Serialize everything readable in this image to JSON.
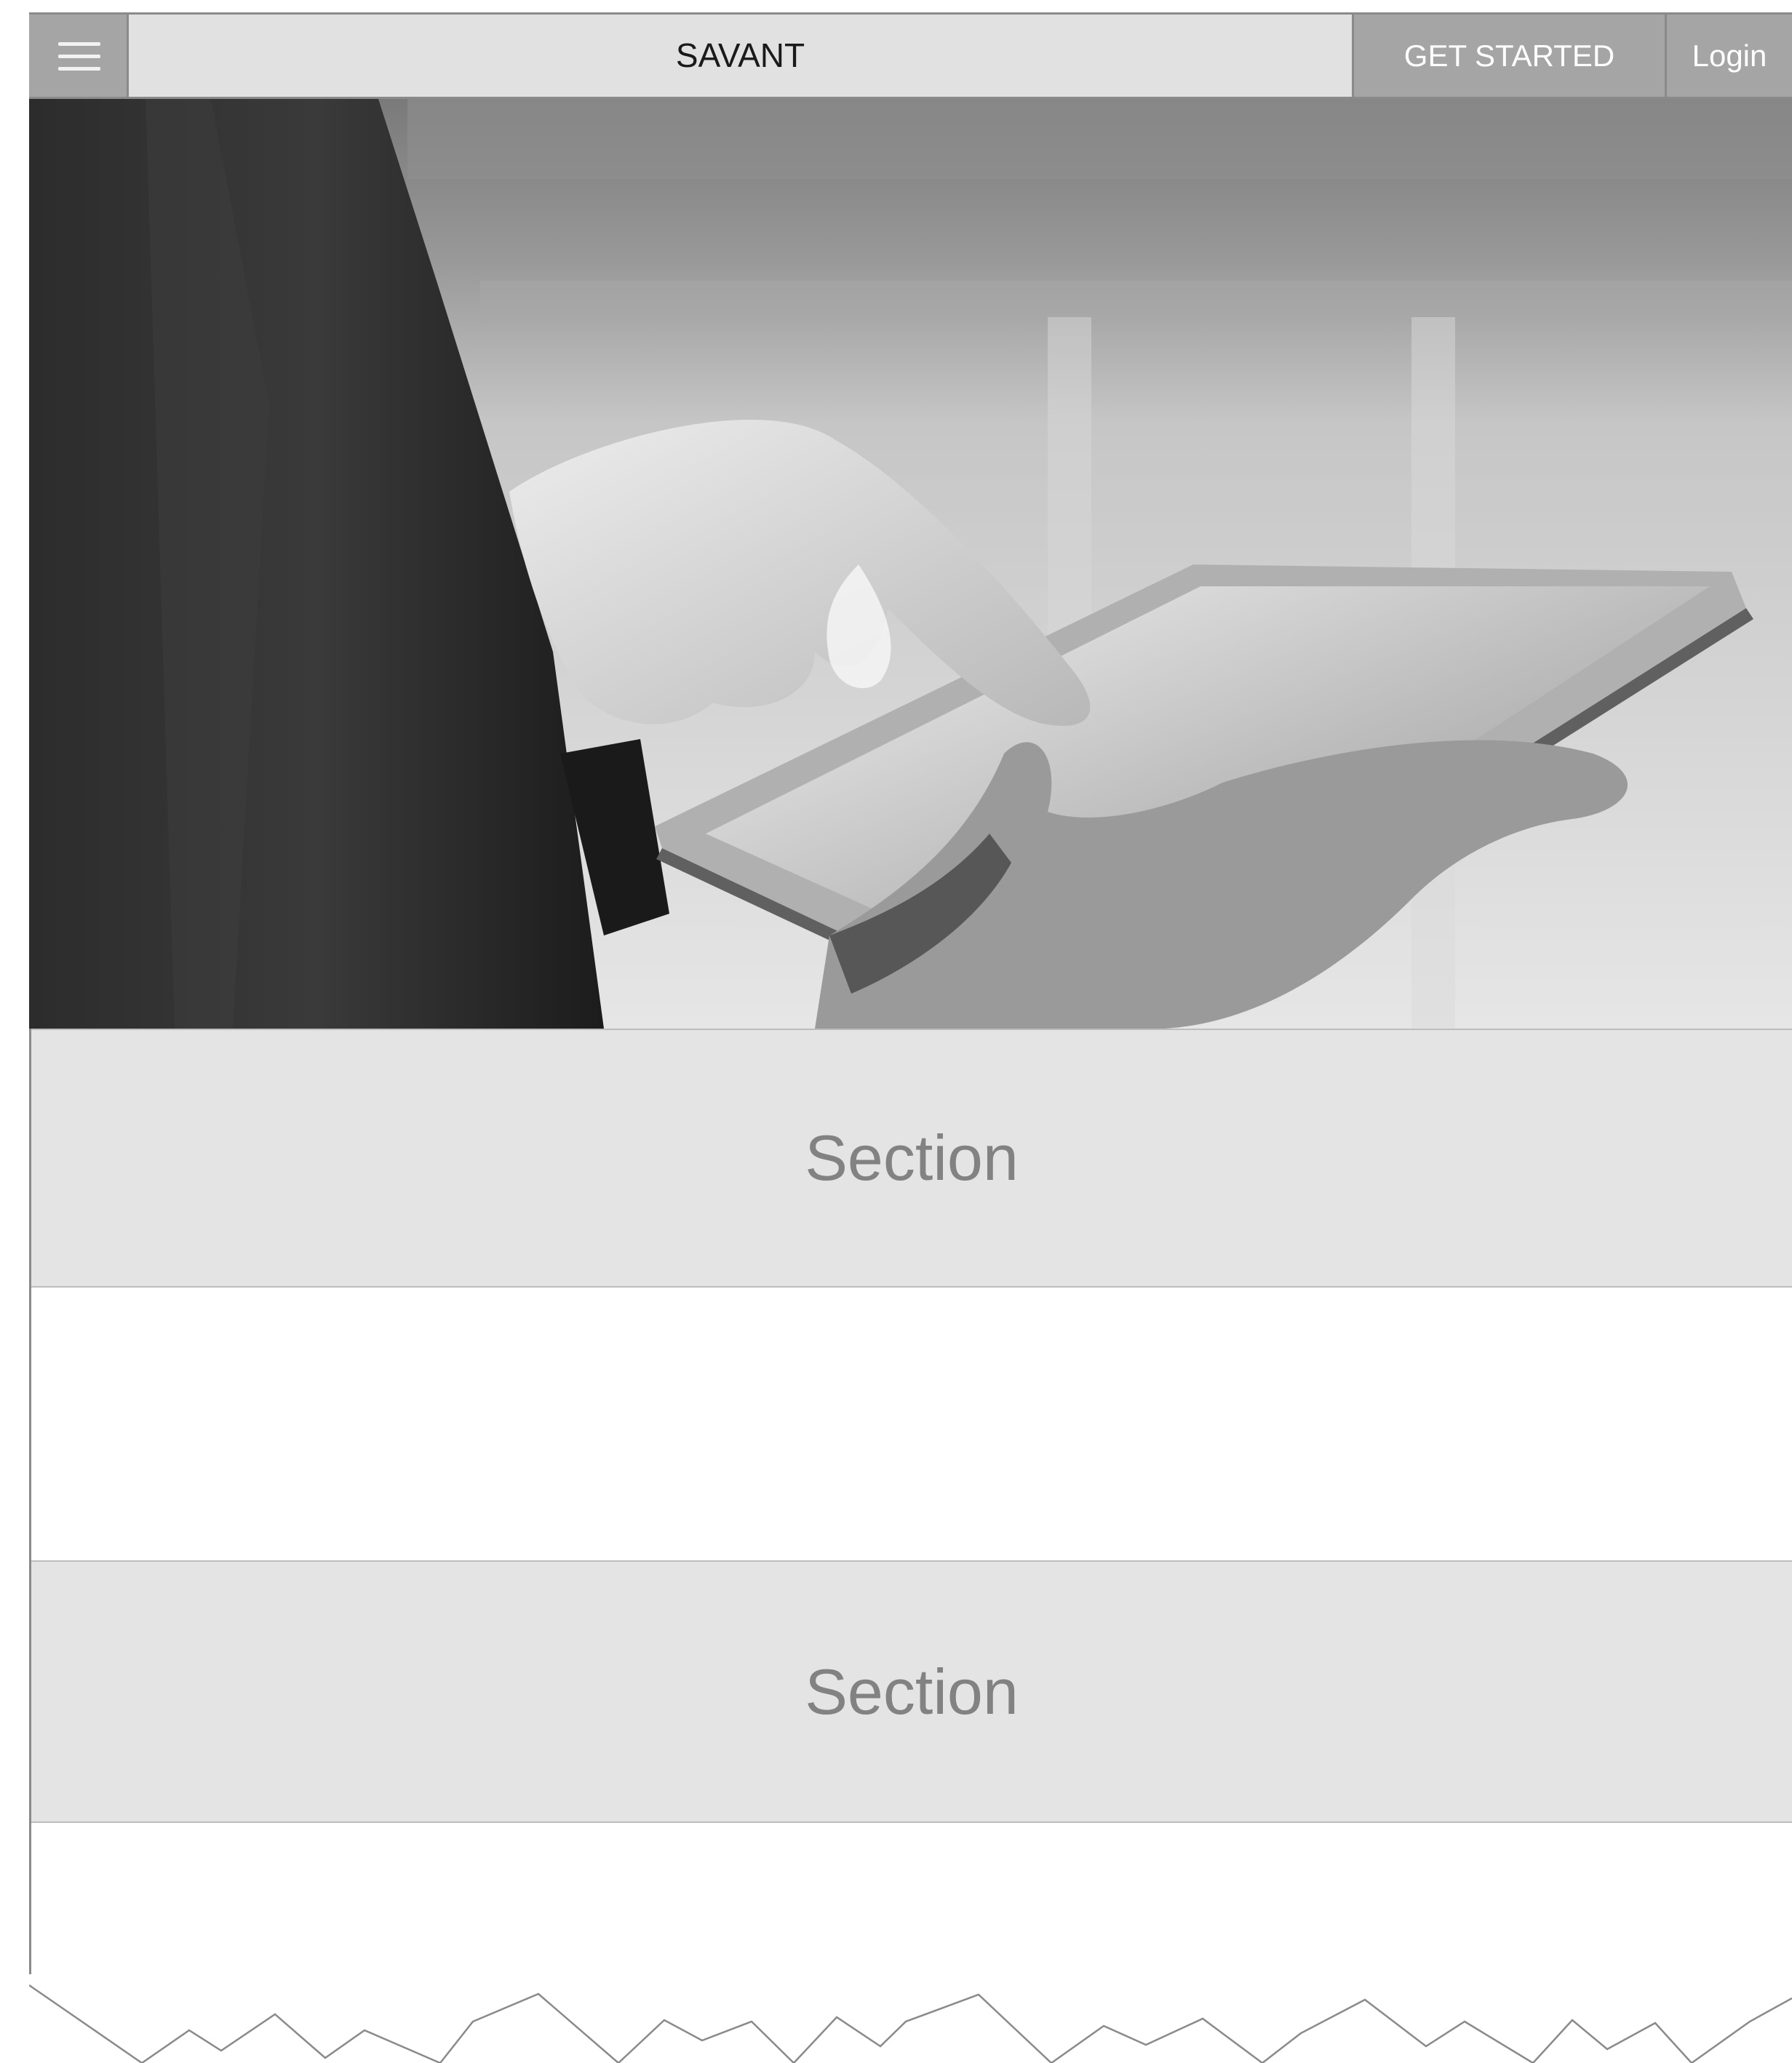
{
  "header": {
    "menu_icon": "hamburger-menu-icon",
    "logo_text": "SAVANT",
    "get_started_label": "GET STARTED",
    "login_label": "Login"
  },
  "hero": {
    "image_description_icon": "hero-photo-hands-with-tablet"
  },
  "sections": [
    {
      "label": "Section"
    },
    {
      "label": "Section"
    }
  ],
  "colors": {
    "header_bg": "#e1e1e1",
    "button_bg": "#a5a5a5",
    "section_bg": "#e4e4e4",
    "section_text": "#828282",
    "border": "#8a8a8a"
  }
}
